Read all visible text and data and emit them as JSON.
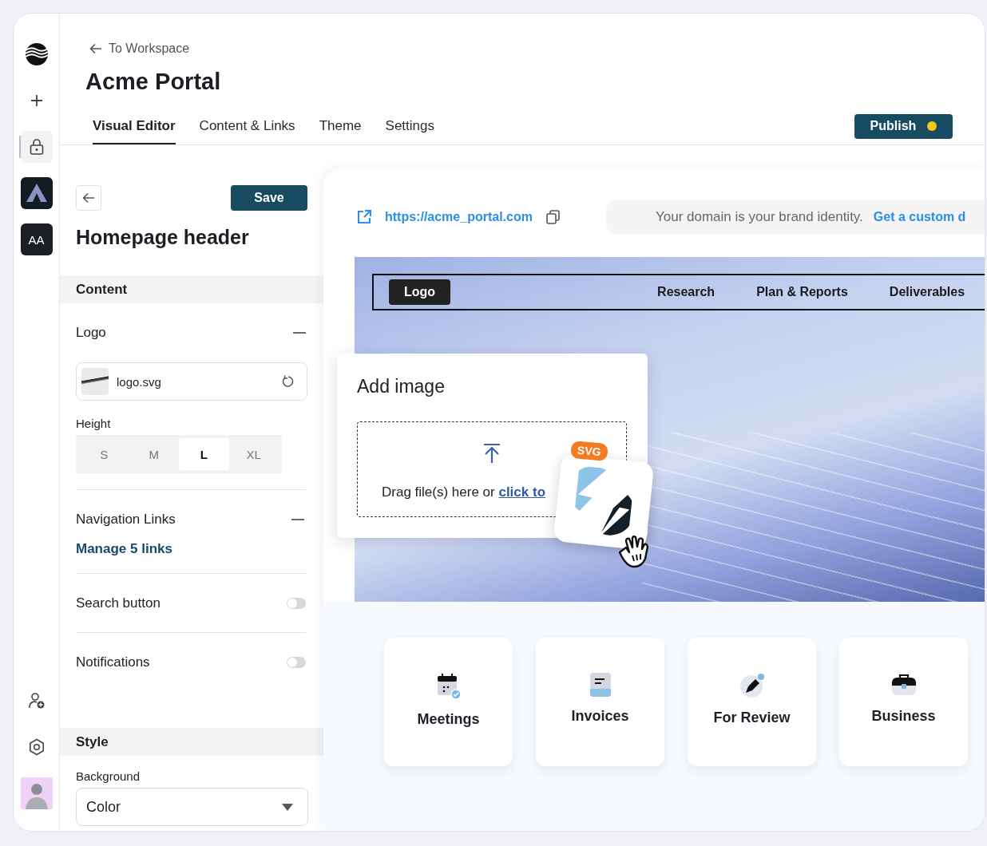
{
  "rail": {
    "top": [
      {
        "kind": "logo",
        "selected": false
      },
      {
        "kind": "add",
        "selected": false
      },
      {
        "kind": "lock",
        "selected": true
      },
      {
        "kind": "app",
        "selected": false
      },
      {
        "kind": "text",
        "label": "AA",
        "selected": false
      }
    ],
    "bottom": [
      {
        "kind": "user-add",
        "selected": false
      },
      {
        "kind": "settings",
        "selected": false
      },
      {
        "kind": "avatar",
        "selected": false
      }
    ]
  },
  "header": {
    "back_link": "To Workspace",
    "title": "Acme Portal",
    "tabs": [
      {
        "label": "Visual Editor",
        "selected": true
      },
      {
        "label": "Content & Links",
        "selected": false
      },
      {
        "label": "Theme",
        "selected": false
      },
      {
        "label": "Settings",
        "selected": false
      }
    ],
    "publish": "Publish"
  },
  "editor": {
    "save": "Save",
    "title": "Homepage header",
    "sections": [
      {
        "heading": "Content",
        "fields": [
          {
            "kind": "file",
            "label": "Logo",
            "expanded": true,
            "file_name": "logo.svg"
          },
          {
            "kind": "segmented",
            "label": "Height",
            "options": [
              {
                "label": "S",
                "selected": false
              },
              {
                "label": "M",
                "selected": false
              },
              {
                "label": "L",
                "selected": true
              },
              {
                "label": "XL",
                "selected": false
              }
            ]
          },
          {
            "kind": "links",
            "label": "Navigation Links",
            "expanded": true,
            "link": "Manage 5 links"
          },
          {
            "kind": "toggle",
            "label": "Search button",
            "on": false
          },
          {
            "kind": "toggle",
            "label": "Notifications",
            "on": false
          }
        ]
      },
      {
        "heading": "Style",
        "fields": [
          {
            "kind": "select",
            "label": "Background",
            "value": "Color"
          }
        ]
      }
    ]
  },
  "preview": {
    "url": "https://acme_portal.com",
    "banner": {
      "text": "Your domain is your brand identity.",
      "link": "Get a custom d"
    },
    "hero": {
      "logo": "Logo",
      "nav": [
        "Research",
        "Plan & Reports",
        "Deliverables"
      ]
    },
    "dialog": {
      "title": "Add image",
      "prompt": "Drag file(s) here or",
      "link": "click to",
      "badge": "SVG"
    },
    "cards": [
      {
        "kind": "calendar",
        "label": "Meetings"
      },
      {
        "kind": "document",
        "label": "Invoices"
      },
      {
        "kind": "pen",
        "label": "For Review"
      },
      {
        "kind": "briefcase",
        "label": "Business"
      }
    ]
  }
}
